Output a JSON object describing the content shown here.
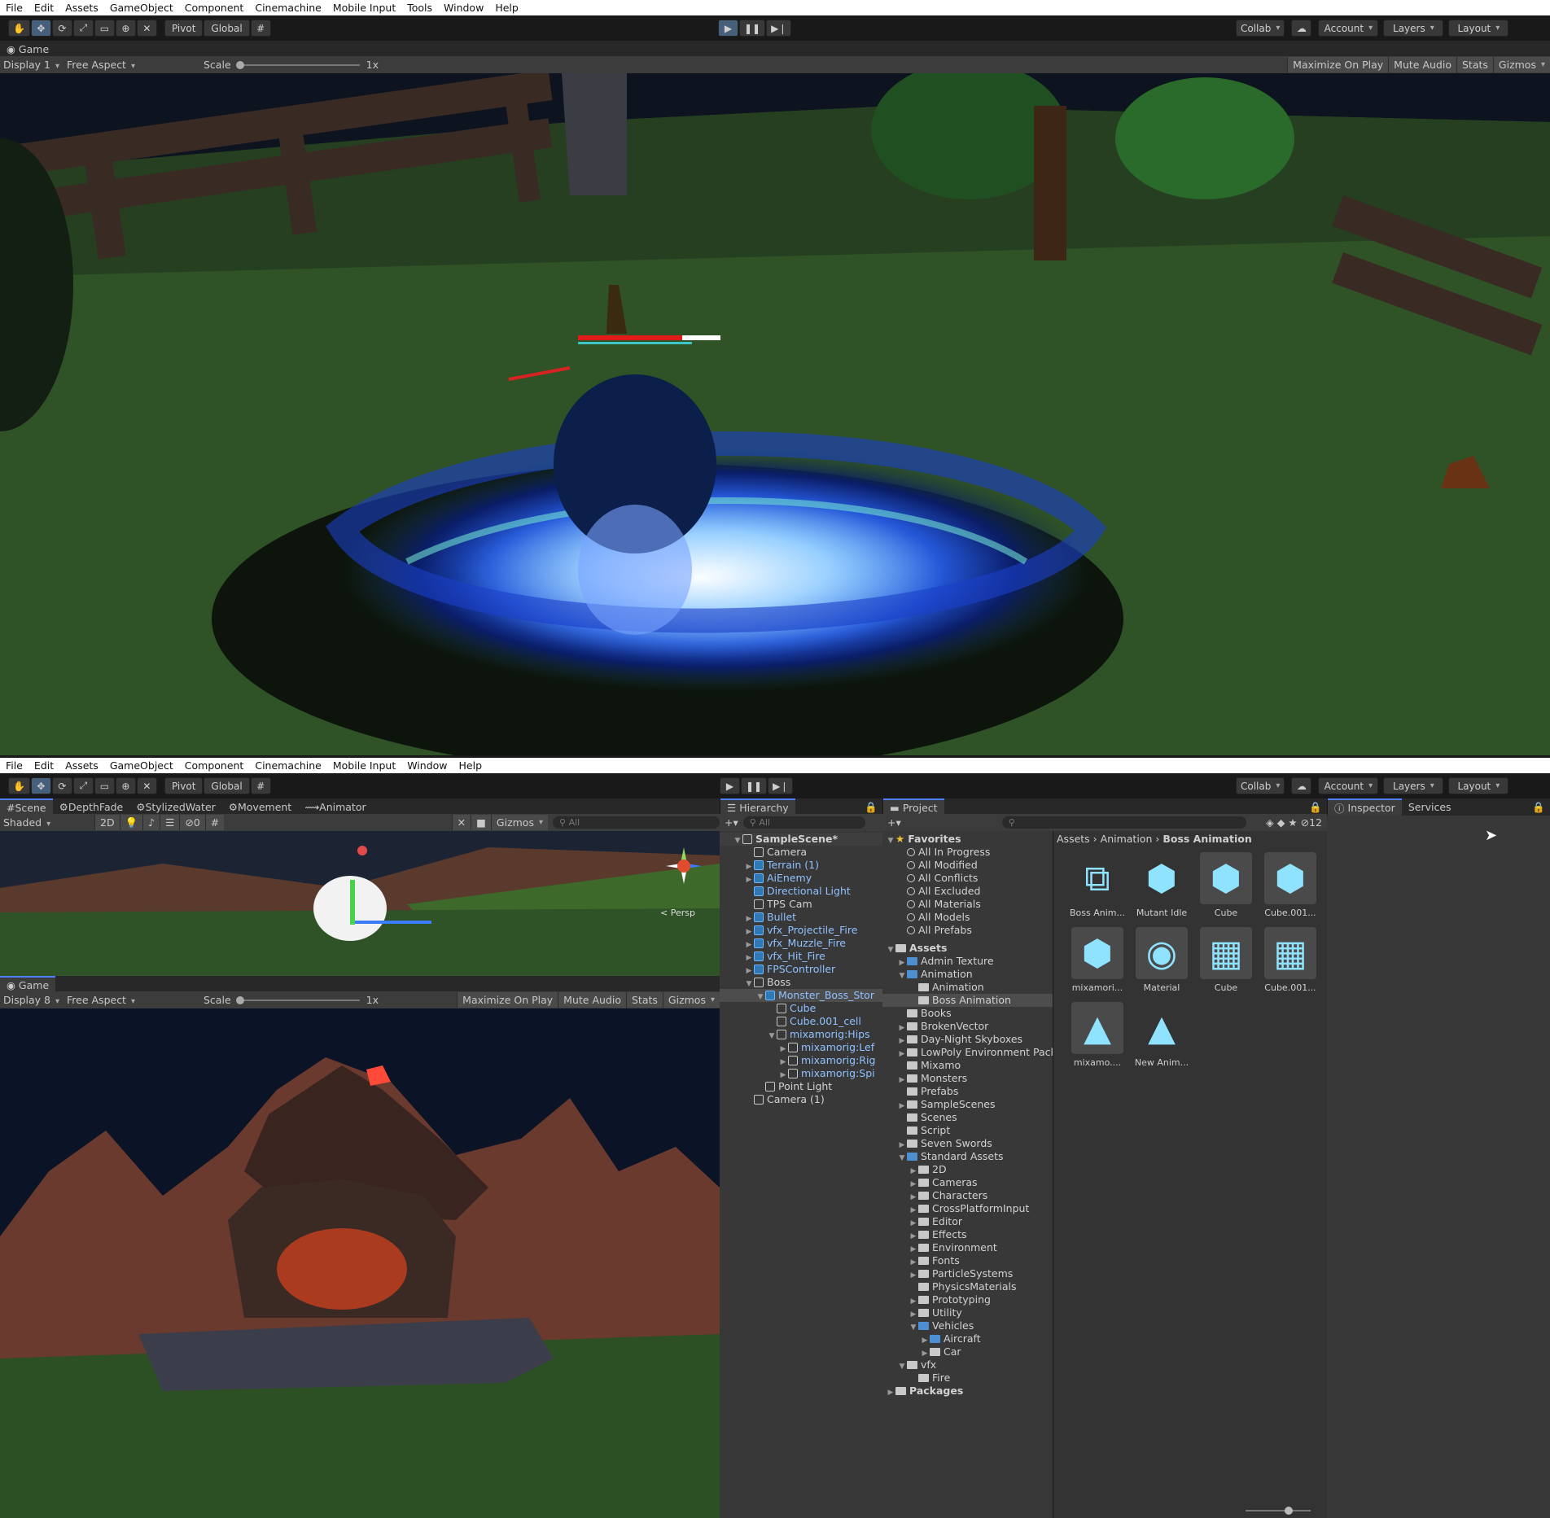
{
  "top": {
    "menu": [
      "File",
      "Edit",
      "Assets",
      "GameObject",
      "Component",
      "Cinemachine",
      "Mobile Input",
      "Tools",
      "Window",
      "Help"
    ],
    "tools": {
      "pivot": "Pivot",
      "global": "Global"
    },
    "right": {
      "collab": "Collab",
      "account": "Account",
      "layers": "Layers",
      "layout": "Layout"
    },
    "game_tab": "Game",
    "game_bar": {
      "display": "Display 1",
      "aspect": "Free Aspect",
      "scale_label": "Scale",
      "scale_value": "1x",
      "maximize": "Maximize On Play",
      "mute": "Mute Audio",
      "stats": "Stats",
      "gizmos": "Gizmos"
    }
  },
  "bottom": {
    "menu": [
      "File",
      "Edit",
      "Assets",
      "GameObject",
      "Component",
      "Cinemachine",
      "Mobile Input",
      "Window",
      "Help"
    ],
    "tools": {
      "pivot": "Pivot",
      "global": "Global"
    },
    "right": {
      "collab": "Collab",
      "account": "Account",
      "layers": "Layers",
      "layout": "Layout"
    },
    "scene_tabs": [
      "Scene",
      "DepthFade",
      "StylizedWater",
      "Movement",
      "Animator"
    ],
    "scene_bar": {
      "shading": "Shaded",
      "mode2d": "2D",
      "hidden_count": "0",
      "gizmos": "Gizmos",
      "search": "All",
      "persp": "< Persp"
    },
    "game_tab": "Game",
    "game_bar": {
      "display": "Display 8",
      "aspect": "Free Aspect",
      "scale_label": "Scale",
      "scale_value": "1x",
      "maximize": "Maximize On Play",
      "mute": "Mute Audio",
      "stats": "Stats",
      "gizmos": "Gizmos"
    },
    "hierarchy": {
      "tab": "Hierarchy",
      "search": "All",
      "items": [
        {
          "label": "SampleScene*",
          "indent": 0,
          "kind": "scene",
          "arrow": "▼"
        },
        {
          "label": "Camera",
          "indent": 1,
          "kind": "obj",
          "arrow": ""
        },
        {
          "label": "Terrain (1)",
          "indent": 1,
          "kind": "prefab",
          "arrow": "▶"
        },
        {
          "label": "AiEnemy",
          "indent": 1,
          "kind": "prefab",
          "arrow": "▶"
        },
        {
          "label": "Directional Light",
          "indent": 1,
          "kind": "prefab",
          "arrow": ""
        },
        {
          "label": "TPS Cam",
          "indent": 1,
          "kind": "obj",
          "arrow": ""
        },
        {
          "label": "Bullet",
          "indent": 1,
          "kind": "prefab",
          "arrow": "▶"
        },
        {
          "label": "vfx_Projectile_Fire",
          "indent": 1,
          "kind": "prefab",
          "arrow": "▶"
        },
        {
          "label": "vfx_Muzzle_Fire",
          "indent": 1,
          "kind": "prefab",
          "arrow": "▶"
        },
        {
          "label": "vfx_Hit_Fire",
          "indent": 1,
          "kind": "prefab",
          "arrow": "▶"
        },
        {
          "label": "FPSController",
          "indent": 1,
          "kind": "prefab",
          "arrow": "▶"
        },
        {
          "label": "Boss",
          "indent": 1,
          "kind": "obj",
          "arrow": "▼"
        },
        {
          "label": "Monster_Boss_Stor",
          "indent": 2,
          "kind": "prefab",
          "arrow": "▼",
          "selected": true
        },
        {
          "label": "Cube",
          "indent": 3,
          "kind": "objb",
          "arrow": ""
        },
        {
          "label": "Cube.001_cell",
          "indent": 3,
          "kind": "objb",
          "arrow": ""
        },
        {
          "label": "mixamorig:Hips",
          "indent": 3,
          "kind": "objb",
          "arrow": "▼"
        },
        {
          "label": "mixamorig:Lef",
          "indent": 4,
          "kind": "objb",
          "arrow": "▶"
        },
        {
          "label": "mixamorig:Rig",
          "indent": 4,
          "kind": "objb",
          "arrow": "▶"
        },
        {
          "label": "mixamorig:Spi",
          "indent": 4,
          "kind": "objb",
          "arrow": "▶"
        },
        {
          "label": "Point Light",
          "indent": 2,
          "kind": "obj",
          "arrow": ""
        },
        {
          "label": "Camera (1)",
          "indent": 1,
          "kind": "obj",
          "arrow": ""
        }
      ]
    },
    "project": {
      "tab": "Project",
      "count": "12",
      "breadcrumb": [
        "Assets",
        "Animation",
        "Boss Animation"
      ],
      "favorites_label": "Favorites",
      "favorites": [
        "All In Progress",
        "All Modified",
        "All Conflicts",
        "All Excluded",
        "All Materials",
        "All Models",
        "All Prefabs"
      ],
      "tree": [
        {
          "label": "Assets",
          "indent": 0,
          "arrow": "▼",
          "bold": true
        },
        {
          "label": "Admin Texture",
          "indent": 1,
          "arrow": "▶",
          "blue": true
        },
        {
          "label": "Animation",
          "indent": 1,
          "arrow": "▼",
          "blue": true
        },
        {
          "label": "Animation",
          "indent": 2,
          "arrow": ""
        },
        {
          "label": "Boss Animation",
          "indent": 2,
          "arrow": "",
          "selected": true
        },
        {
          "label": "Books",
          "indent": 1,
          "arrow": ""
        },
        {
          "label": "BrokenVector",
          "indent": 1,
          "arrow": "▶"
        },
        {
          "label": "Day-Night Skyboxes",
          "indent": 1,
          "arrow": "▶"
        },
        {
          "label": "LowPoly Environment Pack",
          "indent": 1,
          "arrow": "▶"
        },
        {
          "label": "Mixamo",
          "indent": 1,
          "arrow": ""
        },
        {
          "label": "Monsters",
          "indent": 1,
          "arrow": "▶"
        },
        {
          "label": "Prefabs",
          "indent": 1,
          "arrow": ""
        },
        {
          "label": "SampleScenes",
          "indent": 1,
          "arrow": "▶"
        },
        {
          "label": "Scenes",
          "indent": 1,
          "arrow": ""
        },
        {
          "label": "Script",
          "indent": 1,
          "arrow": ""
        },
        {
          "label": "Seven Swords",
          "indent": 1,
          "arrow": "▶"
        },
        {
          "label": "Standard Assets",
          "indent": 1,
          "arrow": "▼",
          "blue": true
        },
        {
          "label": "2D",
          "indent": 2,
          "arrow": "▶"
        },
        {
          "label": "Cameras",
          "indent": 2,
          "arrow": "▶"
        },
        {
          "label": "Characters",
          "indent": 2,
          "arrow": "▶"
        },
        {
          "label": "CrossPlatformInput",
          "indent": 2,
          "arrow": "▶"
        },
        {
          "label": "Editor",
          "indent": 2,
          "arrow": "▶"
        },
        {
          "label": "Effects",
          "indent": 2,
          "arrow": "▶"
        },
        {
          "label": "Environment",
          "indent": 2,
          "arrow": "▶"
        },
        {
          "label": "Fonts",
          "indent": 2,
          "arrow": "▶"
        },
        {
          "label": "ParticleSystems",
          "indent": 2,
          "arrow": "▶"
        },
        {
          "label": "PhysicsMaterials",
          "indent": 2,
          "arrow": ""
        },
        {
          "label": "Prototyping",
          "indent": 2,
          "arrow": "▶"
        },
        {
          "label": "Utility",
          "indent": 2,
          "arrow": "▶"
        },
        {
          "label": "Vehicles",
          "indent": 2,
          "arrow": "▼",
          "blue": true
        },
        {
          "label": "Aircraft",
          "indent": 3,
          "arrow": "▶",
          "blue": true
        },
        {
          "label": "Car",
          "indent": 3,
          "arrow": "▶"
        },
        {
          "label": "vfx",
          "indent": 1,
          "arrow": "▼"
        },
        {
          "label": "Fire",
          "indent": 2,
          "arrow": ""
        },
        {
          "label": "Packages",
          "indent": 0,
          "arrow": "▶",
          "bold": true
        }
      ],
      "assets": [
        {
          "label": "Boss Anim...",
          "icon": "animator-icon"
        },
        {
          "label": "Mutant Idle",
          "icon": "model-plus-icon"
        },
        {
          "label": "Cube",
          "icon": "mesh-icon"
        },
        {
          "label": "Cube.001...",
          "icon": "mesh-icon"
        },
        {
          "label": "mixamori...",
          "icon": "mesh-icon"
        },
        {
          "label": "Material",
          "icon": "material-icon"
        },
        {
          "label": "Cube",
          "icon": "grid-icon"
        },
        {
          "label": "Cube.001...",
          "icon": "grid-icon"
        },
        {
          "label": "mixamo....",
          "icon": "animation-clip-icon"
        },
        {
          "label": "New Anim...",
          "icon": "animation-clip-plus-icon"
        }
      ]
    },
    "inspector": {
      "tab": "Inspector",
      "services": "Services"
    }
  },
  "colors": {
    "accent": "#4c7fff",
    "play_active": "#46607c",
    "selection": "#2c5d87"
  }
}
